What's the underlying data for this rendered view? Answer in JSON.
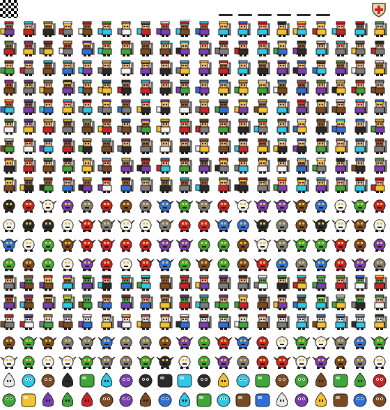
{
  "sheet": {
    "background": "#ffffff",
    "transparent_marker": "checkerboard-icon",
    "palette": {
      "skin": "#e8b07a",
      "skin_dark": "#8a5a35",
      "outline": "#1a1410",
      "gold": "#f2c230",
      "red": "#c8242a",
      "blue": "#2f6fd6",
      "cyan": "#2ec8e8",
      "green": "#3fa63a",
      "purple": "#7a3fb0",
      "grey": "#7d7d80",
      "brown": "#7a4a22",
      "white": "#f2f2f2",
      "black": "#2a2a2a"
    },
    "bands": [
      {
        "name": "humans-row-0",
        "kind": "humanoid",
        "count": 20
      },
      {
        "name": "humans-row-1",
        "kind": "humanoid",
        "count": 20
      },
      {
        "name": "humans-row-2",
        "kind": "humanoid",
        "count": 20
      },
      {
        "name": "humans-row-3",
        "kind": "humanoid",
        "count": 20
      },
      {
        "name": "humans-row-4",
        "kind": "humanoid",
        "count": 20
      },
      {
        "name": "humans-row-5",
        "kind": "humanoid",
        "count": 20
      },
      {
        "name": "humans-row-6",
        "kind": "humanoid",
        "count": 20
      },
      {
        "name": "humans-row-7",
        "kind": "humanoid",
        "count": 20
      },
      {
        "name": "humans-row-8",
        "kind": "humanoid",
        "count": 20
      },
      {
        "name": "monsters-row-9",
        "kind": "monster",
        "count": 20
      },
      {
        "name": "monsters-row-10",
        "kind": "monster",
        "count": 20
      },
      {
        "name": "monsters-row-11",
        "kind": "monster",
        "count": 20
      },
      {
        "name": "monsters-row-12",
        "kind": "monster",
        "count": 20
      },
      {
        "name": "goblins-row-13",
        "kind": "humanoid",
        "count": 20
      },
      {
        "name": "goblins-row-14",
        "kind": "humanoid",
        "count": 20
      },
      {
        "name": "undead-row-15",
        "kind": "humanoid",
        "count": 20
      },
      {
        "name": "beasts-row-16",
        "kind": "monster",
        "count": 20
      },
      {
        "name": "beasts-row-17",
        "kind": "monster",
        "count": 20
      },
      {
        "name": "slimes-row-18",
        "kind": "slime",
        "count": 20
      },
      {
        "name": "slimes-row-19",
        "kind": "slime",
        "count": 20
      }
    ]
  }
}
